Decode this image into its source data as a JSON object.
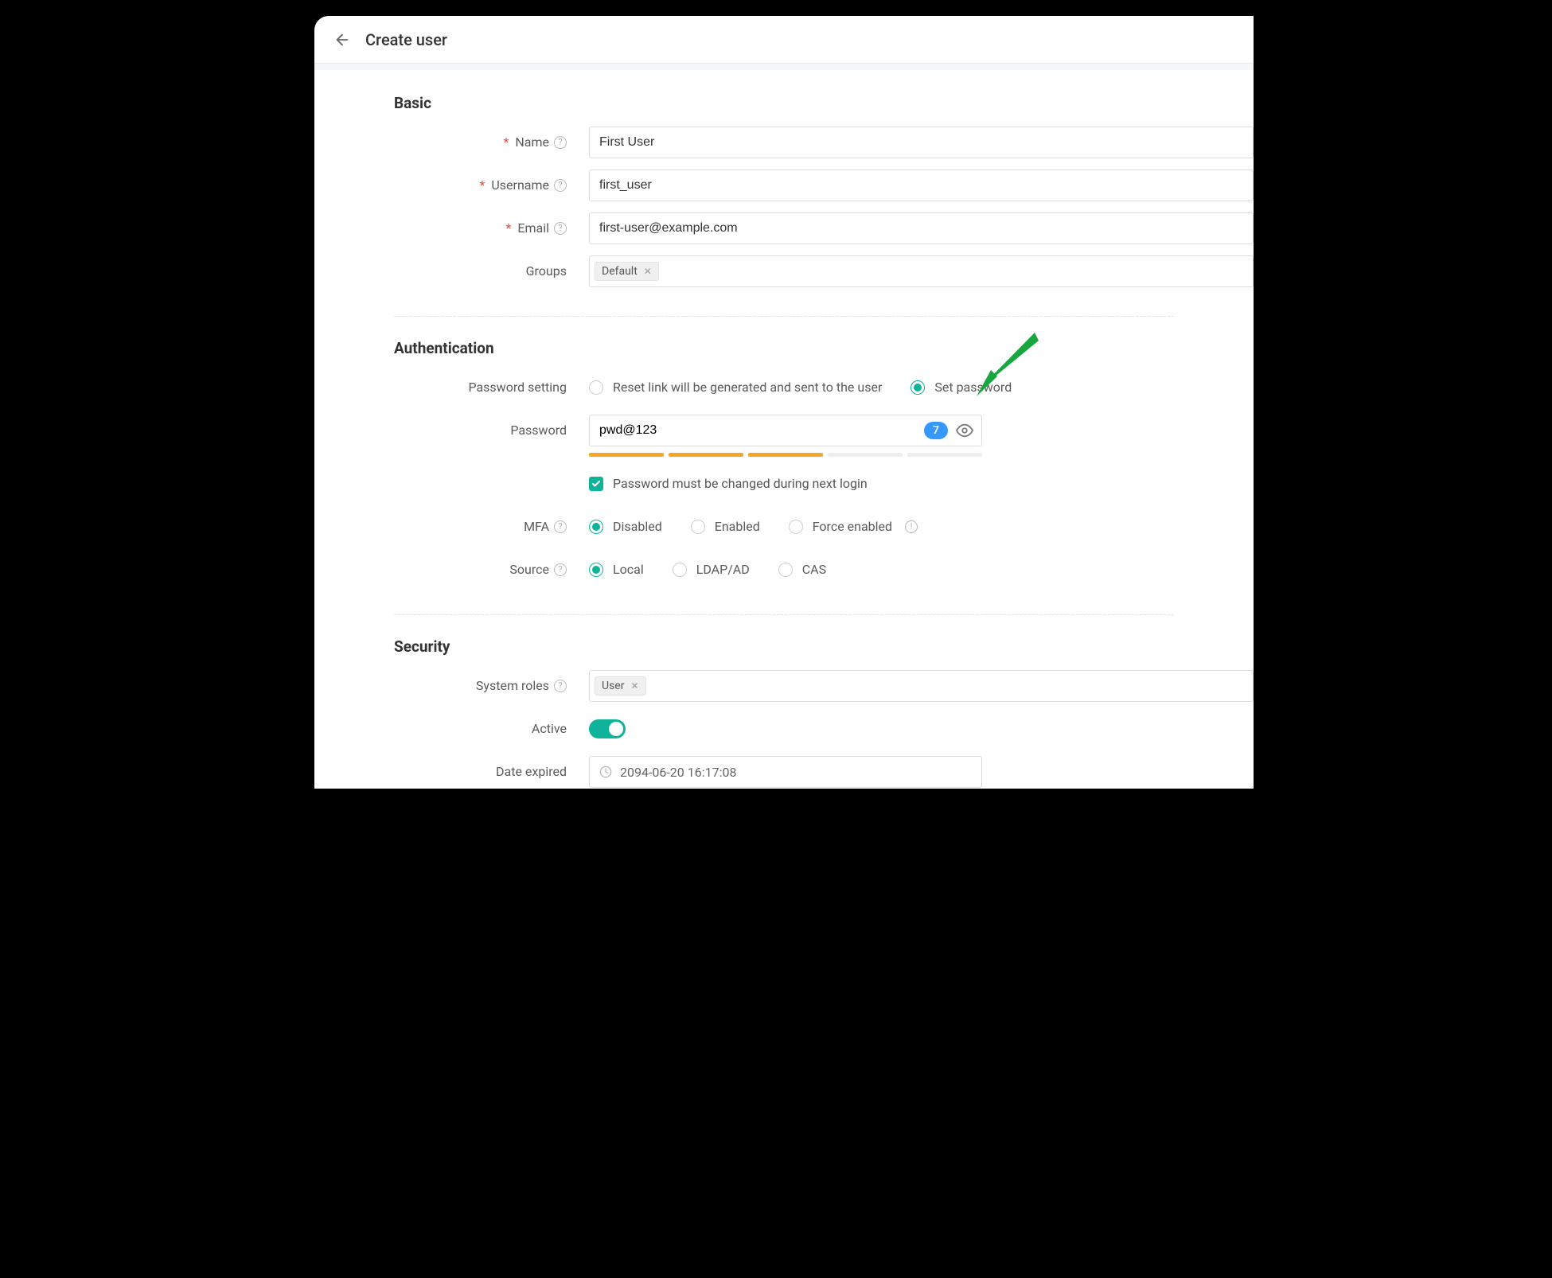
{
  "header": {
    "title": "Create user"
  },
  "sections": {
    "basic": {
      "title": "Basic"
    },
    "auth": {
      "title": "Authentication"
    },
    "security": {
      "title": "Security"
    }
  },
  "labels": {
    "name": "Name",
    "username": "Username",
    "email": "Email",
    "groups": "Groups",
    "password_setting": "Password setting",
    "password": "Password",
    "mfa": "MFA",
    "source": "Source",
    "system_roles": "System roles",
    "active": "Active",
    "date_expired": "Date expired"
  },
  "values": {
    "name": "First User",
    "username": "first_user",
    "email": "first-user@example.com",
    "groups_tag": "Default",
    "password": "pwd@123",
    "password_len": "7",
    "must_change_label": "Password must be changed during next login",
    "system_roles_tag": "User",
    "date_expired": "2094-06-20 16:17:08"
  },
  "password_setting_options": {
    "reset_link": "Reset link will be generated and sent to the user",
    "set_password": "Set password"
  },
  "mfa_options": {
    "disabled": "Disabled",
    "enabled": "Enabled",
    "force_enabled": "Force enabled"
  },
  "source_options": {
    "local": "Local",
    "ldap": "LDAP/AD",
    "cas": "CAS"
  },
  "colors": {
    "accent": "#0eb39a",
    "warn": "#f5a623",
    "badge": "#3498ff",
    "arrow": "#19a63e"
  }
}
